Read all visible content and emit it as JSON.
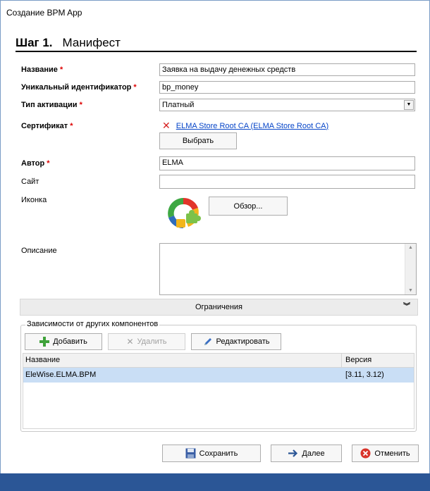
{
  "window": {
    "title": "Создание BPM App"
  },
  "step": {
    "number": "Шаг 1.",
    "name": "Манифест"
  },
  "form": {
    "name_label": "Название",
    "name_value": "Заявка на выдачу денежных средств",
    "id_label": "Уникальный идентификатор",
    "id_value": "bp_money",
    "activation_label": "Тип активации",
    "activation_value": "Платный",
    "cert_label": "Сертификат",
    "cert_value": "ELMA Store Root CA (ELMA Store Root CA)",
    "choose_label": "Выбрать",
    "author_label": "Автор",
    "author_value": "ELMA",
    "site_label": "Сайт",
    "site_value": "",
    "icon_label": "Иконка",
    "browse_label": "Обзор...",
    "desc_label": "Описание",
    "desc_value": "",
    "required_mark": "*"
  },
  "restrictions": {
    "label": "Ограничения"
  },
  "dependencies": {
    "title": "Зависимости от других компонентов",
    "add_label": "Добавить",
    "delete_label": "Удалить",
    "edit_label": "Редактировать",
    "columns": [
      "Название",
      "Версия"
    ],
    "rows": [
      {
        "name": "EleWise.ELMA.BPM",
        "version": "[3.11, 3.12)"
      }
    ]
  },
  "footer": {
    "save_label": "Сохранить",
    "next_label": "Далее",
    "cancel_label": "Отменить"
  },
  "colors": {
    "accent": "#2b5696",
    "required": "#dd0000",
    "link": "#0645c8",
    "selected_row": "#c9def5"
  },
  "icons": [
    "remove-icon",
    "add-icon",
    "delete-icon",
    "edit-icon",
    "save-icon",
    "next-arrow-icon",
    "cancel-icon",
    "app-logo-icon",
    "chevron-down-icon",
    "double-chevron-down-icon"
  ]
}
